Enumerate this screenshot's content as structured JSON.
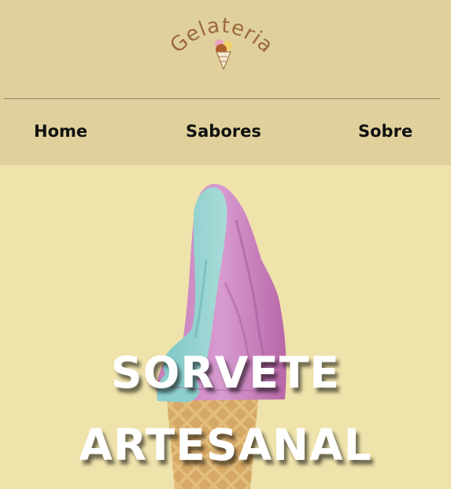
{
  "brand": {
    "logo_text": "Gelateria",
    "logo_icon": "ice-cream-cone-icon"
  },
  "nav": {
    "items": [
      {
        "label": "Home"
      },
      {
        "label": "Sabores"
      },
      {
        "label": "Sobre"
      }
    ]
  },
  "hero": {
    "image": "soft-serve-ice-cream-cone",
    "title_line1": "SORVETE",
    "title_line2": "ARTESANAL"
  },
  "colors": {
    "header_bg": "#dfd09c",
    "hero_bg": "#efe3ac",
    "divider": "#8c7f6b",
    "nav_text": "#111111",
    "logo_text": "#9b6a3c",
    "hero_title": "#ffffff"
  }
}
